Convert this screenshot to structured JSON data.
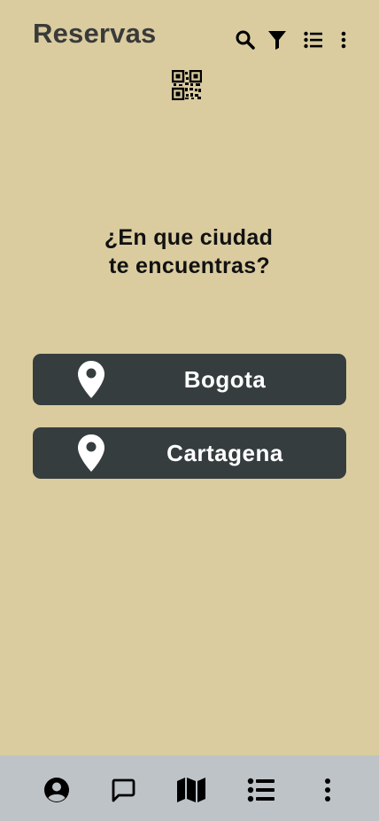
{
  "header": {
    "title": "Reservas",
    "icons": [
      "search-icon",
      "filter-icon",
      "list-icon",
      "more-vertical-icon",
      "qr-code-icon"
    ]
  },
  "main": {
    "question_line1": "¿En que ciudad",
    "question_line2": "te encuentras?",
    "cities": [
      {
        "label": "Bogota",
        "icon": "location-pin-icon"
      },
      {
        "label": "Cartagena",
        "icon": "location-pin-icon"
      }
    ]
  },
  "bottom_nav": {
    "items": [
      "account-icon",
      "chat-icon",
      "map-icon",
      "list-icon",
      "more-vertical-icon"
    ]
  },
  "colors": {
    "background": "#dacc9f",
    "button": "#363d3f",
    "bottom_bar": "#bec3c7",
    "title": "#3a3a3a"
  }
}
